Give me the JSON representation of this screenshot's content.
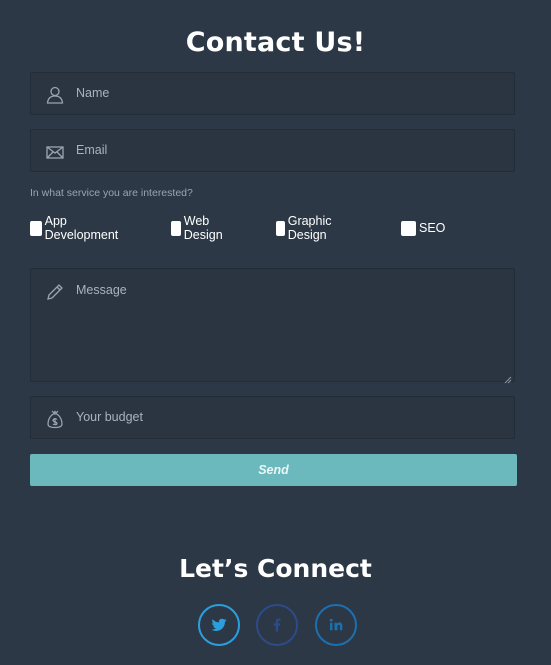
{
  "form": {
    "title": "Contact Us!",
    "name_placeholder": "Name",
    "email_placeholder": "Email",
    "service_question": "In what service you are interested?",
    "services": [
      {
        "label": "App Development",
        "checked": false
      },
      {
        "label": "Web Design",
        "checked": false
      },
      {
        "label": "Graphic Design",
        "checked": false
      },
      {
        "label": "SEO",
        "checked": false
      }
    ],
    "message_placeholder": "Message",
    "budget_placeholder": "Your budget",
    "send_label": "Send"
  },
  "connect": {
    "title": "Let’s Connect",
    "links": [
      {
        "icon": "twitter-icon",
        "color": "#2a9fe0"
      },
      {
        "icon": "facebook-icon",
        "color": "#2d4a8a"
      },
      {
        "icon": "linkedin-icon",
        "color": "#1d6fb0"
      }
    ]
  },
  "colors": {
    "background": "#2c3845",
    "field": "#2a3541",
    "button": "#6bb8bd"
  }
}
